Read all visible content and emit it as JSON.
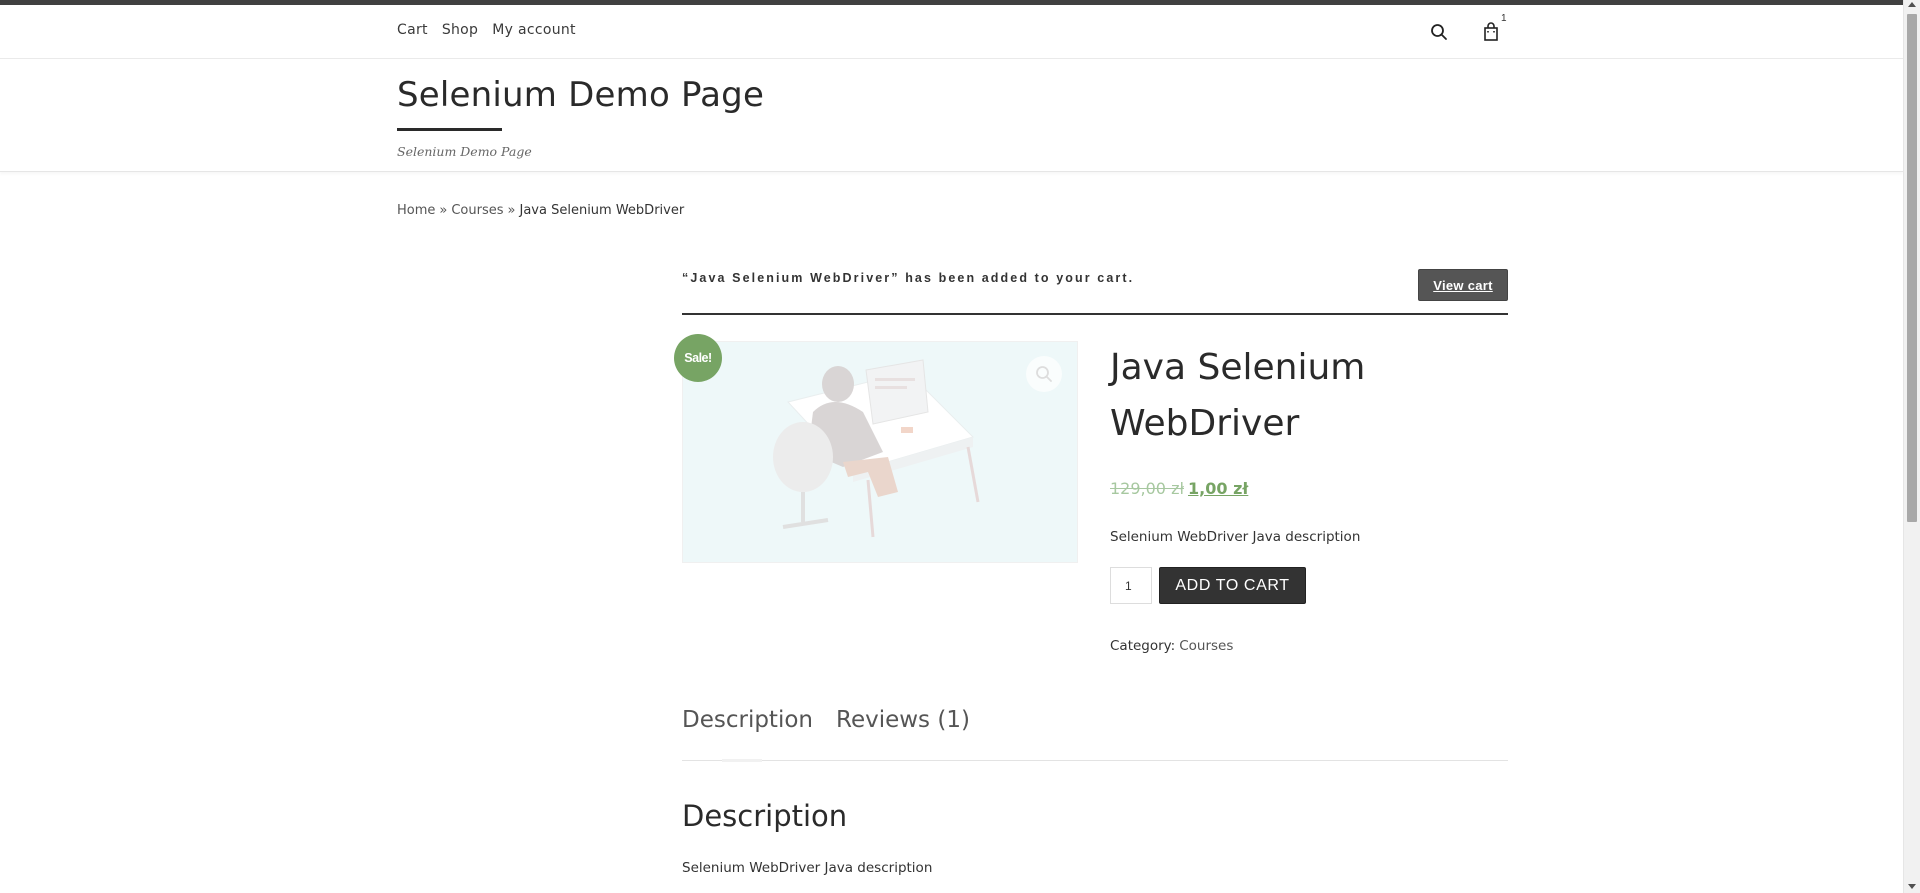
{
  "nav": {
    "items": [
      "Cart",
      "Shop",
      "My account"
    ],
    "cart_count": "1"
  },
  "header": {
    "site_title": "Selenium Demo Page",
    "tagline": "Selenium Demo Page"
  },
  "breadcrumb": {
    "home": "Home",
    "sep1": "»",
    "courses": "Courses",
    "sep2": "»",
    "current": "Java Selenium WebDriver"
  },
  "notice": {
    "message": "“Java Selenium WebDriver” has been added to your cart.",
    "view_cart_label": "View cart"
  },
  "product": {
    "sale_badge": "Sale!",
    "title": "Java Selenium WebDriver",
    "price_old": "129,00 zł",
    "price_new": "1,00 zł",
    "short_description": "Selenium WebDriver Java description",
    "quantity": "1",
    "add_to_cart_label": "ADD TO CART",
    "category_label": "Category:",
    "category_value": "Courses"
  },
  "tabs": {
    "description": "Description",
    "reviews": "Reviews (1)"
  },
  "description": {
    "heading": "Description",
    "body": "Selenium WebDriver Java description"
  },
  "colors": {
    "sale_green": "#77a464",
    "dark_button": "#333333",
    "view_cart_bg": "#555555"
  }
}
